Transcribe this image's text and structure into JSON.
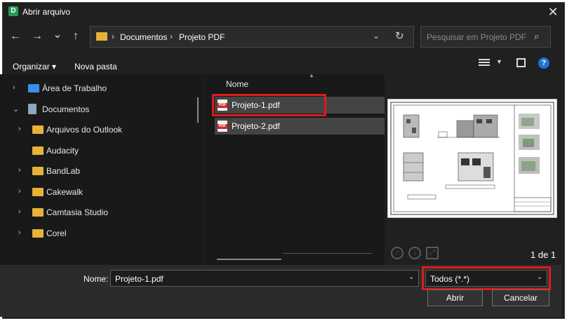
{
  "window": {
    "title": "Abrir arquivo",
    "app_icon_letter": "D",
    "app_icon_color": "#1f9d55"
  },
  "nav_buttons": {
    "back": "←",
    "forward": "→",
    "recent": "⌄",
    "up": "↑"
  },
  "address": {
    "crumbs": [
      "Documentos",
      "Projeto PDF"
    ],
    "separator": "›"
  },
  "search": {
    "placeholder": "Pesquisar em Projeto PDF"
  },
  "toolbar": {
    "organize": "Organizar ▾",
    "new_folder": "Nova pasta"
  },
  "nav_tree": [
    {
      "label": "Área de Trabalho",
      "icon": "desktop-icon",
      "expanded": false
    },
    {
      "label": "Documentos",
      "icon": "documents-icon",
      "expanded": true
    },
    {
      "label": "Arquivos do Outlook",
      "icon": "folder-icon",
      "expanded": false
    },
    {
      "label": "Audacity",
      "icon": "folder-icon",
      "expanded": null
    },
    {
      "label": "BandLab",
      "icon": "folder-icon",
      "expanded": false
    },
    {
      "label": "Cakewalk",
      "icon": "folder-icon",
      "expanded": false
    },
    {
      "label": "Camtasia Studio",
      "icon": "folder-icon",
      "expanded": false
    },
    {
      "label": "Corel",
      "icon": "folder-icon",
      "expanded": false
    }
  ],
  "file_list": {
    "column": "Nome",
    "files": [
      {
        "name": "Projeto-1.pdf",
        "selected": true
      },
      {
        "name": "Projeto-2.pdf",
        "selected": false
      }
    ]
  },
  "preview": {
    "page_info": "1 de 1"
  },
  "footer": {
    "name_label": "Nome:",
    "name_value": "Projeto-1.pdf",
    "filter_value": "Todos (*.*)",
    "open_label": "Abrir",
    "cancel_label": "Cancelar"
  },
  "colors": {
    "highlight": "#e01b1b",
    "folder": "#e8b13a",
    "pdf": "#d42b2b",
    "help": "#1e73d6"
  }
}
